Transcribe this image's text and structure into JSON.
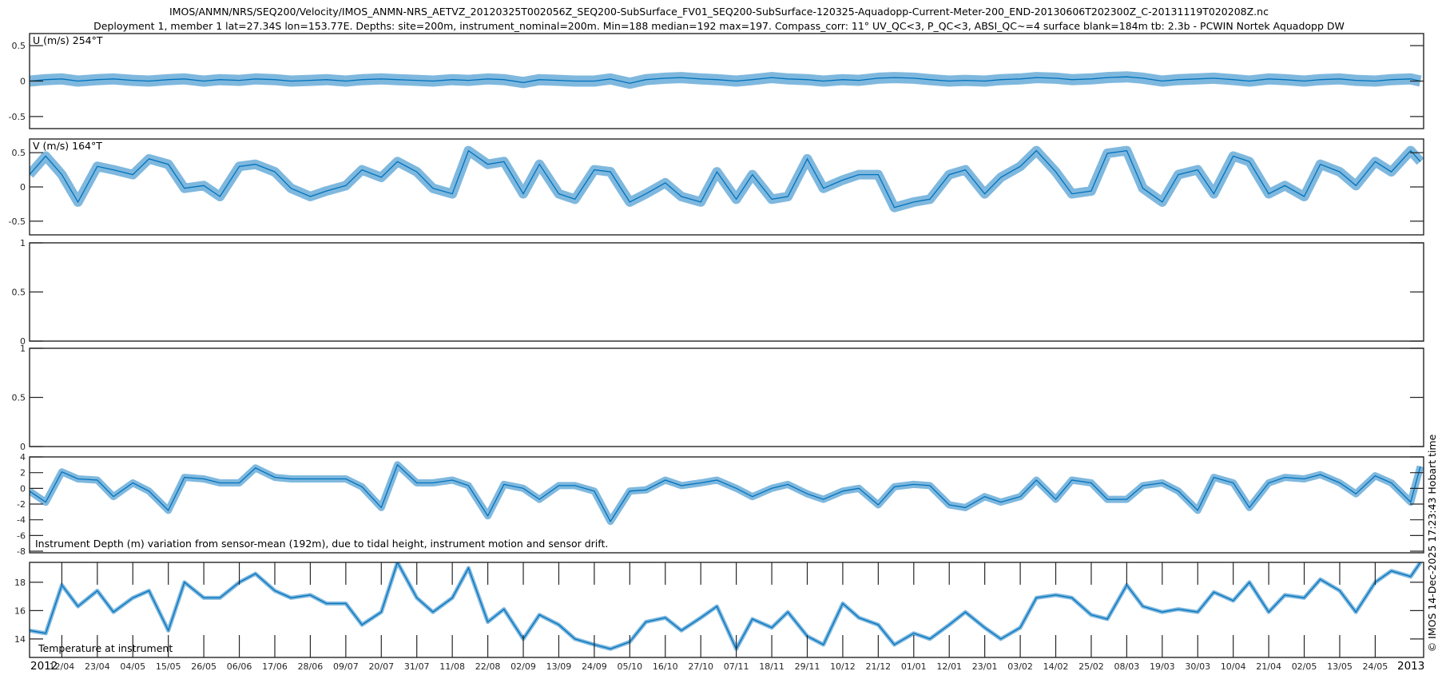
{
  "title_line1": "IMOS/ANMN/NRS/SEQ200/Velocity/IMOS_ANMN-NRS_AETVZ_20120325T002056Z_SEQ200-SubSurface_FV01_SEQ200-SubSurface-120325-Aquadopp-Current-Meter-200_END-20130606T202300Z_C-20131119T020208Z.nc",
  "title_line2": "Deployment 1, member 1 lat=27.34S lon=153.77E. Depths: site=200m, instrument_nominal=200m. Min=188 median=192 max=197. Compass_corr: 11° UV_QC<3, P_QC<3, ABSI_QC~=4 surface blank=184m tb: 2.3b - PCWIN Nortek Aquadopp DW",
  "copyright": "© IMOS 14-Dec-2025 17:23:43 Hobart time",
  "line_color": "#0072BD",
  "xaxis": {
    "xlim": [
      "2012-04-02",
      "2013-06-08"
    ],
    "year_start_label": "2012",
    "year_end_label": "2013",
    "tick_dates": [
      "2012-04-12",
      "2012-04-23",
      "2012-05-04",
      "2012-05-15",
      "2012-05-26",
      "2012-06-06",
      "2012-06-17",
      "2012-06-28",
      "2012-07-09",
      "2012-07-20",
      "2012-07-31",
      "2012-08-11",
      "2012-08-22",
      "2012-09-02",
      "2012-09-13",
      "2012-09-24",
      "2012-10-05",
      "2012-10-16",
      "2012-10-27",
      "2012-11-07",
      "2012-11-18",
      "2012-11-29",
      "2012-12-10",
      "2012-12-21",
      "2013-01-01",
      "2013-01-12",
      "2013-01-23",
      "2013-02-03",
      "2013-02-14",
      "2013-02-25",
      "2013-03-08",
      "2013-03-19",
      "2013-03-30",
      "2013-04-10",
      "2013-04-21",
      "2013-05-02",
      "2013-05-13",
      "2013-05-24"
    ],
    "tick_labels": [
      "12/04",
      "23/04",
      "04/05",
      "15/05",
      "26/05",
      "06/06",
      "17/06",
      "28/06",
      "09/07",
      "20/07",
      "31/07",
      "11/08",
      "22/08",
      "02/09",
      "13/09",
      "24/09",
      "05/10",
      "16/10",
      "27/10",
      "07/11",
      "18/11",
      "29/11",
      "10/12",
      "21/12",
      "01/01",
      "12/01",
      "23/01",
      "03/02",
      "14/02",
      "25/02",
      "08/03",
      "19/03",
      "30/03",
      "10/04",
      "21/04",
      "02/05",
      "13/05",
      "24/05"
    ]
  },
  "chart_data": [
    {
      "type": "line",
      "label": "U (m/s) 254°T",
      "ylim": [
        -0.67,
        0.67
      ],
      "yticks": [
        0.5,
        0,
        -0.5
      ],
      "ytick_labels": [
        "0.5",
        "0",
        "-0.5"
      ],
      "x": [
        "2012-04-02",
        "2012-04-07",
        "2012-04-12",
        "2012-04-17",
        "2012-04-23",
        "2012-04-28",
        "2012-05-04",
        "2012-05-09",
        "2012-05-15",
        "2012-05-20",
        "2012-05-26",
        "2012-05-31",
        "2012-06-06",
        "2012-06-11",
        "2012-06-17",
        "2012-06-22",
        "2012-06-28",
        "2012-07-03",
        "2012-07-09",
        "2012-07-14",
        "2012-07-20",
        "2012-07-25",
        "2012-07-31",
        "2012-08-05",
        "2012-08-11",
        "2012-08-16",
        "2012-08-22",
        "2012-08-27",
        "2012-09-02",
        "2012-09-07",
        "2012-09-13",
        "2012-09-18",
        "2012-09-24",
        "2012-09-29",
        "2012-10-05",
        "2012-10-10",
        "2012-10-16",
        "2012-10-21",
        "2012-10-27",
        "2012-11-01",
        "2012-11-07",
        "2012-11-12",
        "2012-11-18",
        "2012-11-23",
        "2012-11-29",
        "2012-12-04",
        "2012-12-10",
        "2012-12-15",
        "2012-12-21",
        "2012-12-26",
        "2013-01-01",
        "2013-01-06",
        "2013-01-12",
        "2013-01-17",
        "2013-01-23",
        "2013-01-28",
        "2013-02-03",
        "2013-02-08",
        "2013-02-14",
        "2013-02-19",
        "2013-02-25",
        "2013-03-02",
        "2013-03-08",
        "2013-03-13",
        "2013-03-19",
        "2013-03-24",
        "2013-03-30",
        "2013-04-04",
        "2013-04-10",
        "2013-04-15",
        "2013-04-21",
        "2013-04-26",
        "2013-05-02",
        "2013-05-07",
        "2013-05-13",
        "2013-05-18",
        "2013-05-24",
        "2013-05-29",
        "2013-06-04",
        "2013-06-07"
      ],
      "values": [
        0.0,
        0.02,
        0.03,
        0.0,
        0.02,
        0.03,
        0.01,
        0.0,
        0.02,
        0.03,
        0.0,
        0.02,
        0.01,
        0.03,
        0.02,
        0.0,
        0.01,
        0.02,
        0.0,
        0.02,
        0.03,
        0.02,
        0.01,
        0.0,
        0.02,
        0.01,
        0.03,
        0.02,
        -0.02,
        0.02,
        0.01,
        0.0,
        0.0,
        0.03,
        -0.03,
        0.02,
        0.04,
        0.05,
        0.03,
        0.02,
        0.0,
        0.02,
        0.05,
        0.03,
        0.02,
        0.0,
        0.02,
        0.01,
        0.04,
        0.05,
        0.04,
        0.02,
        0.0,
        0.01,
        0.0,
        0.02,
        0.03,
        0.05,
        0.04,
        0.02,
        0.03,
        0.05,
        0.06,
        0.04,
        0.0,
        0.02,
        0.03,
        0.04,
        0.02,
        0.0,
        0.03,
        0.02,
        0.0,
        0.02,
        0.03,
        0.01,
        0.0,
        0.02,
        0.03,
        0.0
      ]
    },
    {
      "type": "line",
      "label": "V (m/s) 164°T",
      "ylim": [
        -0.7,
        0.7
      ],
      "yticks": [
        0.5,
        0,
        -0.5
      ],
      "ytick_labels": [
        "0.5",
        "0",
        "-0.5"
      ],
      "values": [
        0.18,
        0.45,
        0.18,
        -0.22,
        0.3,
        0.25,
        0.18,
        0.41,
        0.33,
        -0.02,
        0.02,
        -0.14,
        0.3,
        0.33,
        0.22,
        -0.02,
        -0.14,
        -0.06,
        0.02,
        0.25,
        0.14,
        0.37,
        0.22,
        -0.02,
        -0.1,
        0.53,
        0.33,
        0.37,
        -0.1,
        0.33,
        -0.1,
        -0.18,
        0.25,
        0.22,
        -0.22,
        -0.1,
        0.06,
        -0.14,
        -0.22,
        0.22,
        -0.18,
        0.18,
        -0.18,
        -0.14,
        0.41,
        -0.02,
        0.1,
        0.18,
        0.18,
        -0.3,
        -0.22,
        -0.18,
        0.18,
        0.25,
        -0.1,
        0.14,
        0.3,
        0.53,
        0.22,
        -0.1,
        -0.06,
        0.49,
        0.53,
        -0.02,
        -0.22,
        0.18,
        0.25,
        -0.1,
        0.45,
        0.37,
        -0.1,
        0.02,
        -0.14,
        0.33,
        0.22,
        0.02,
        0.37,
        0.22,
        0.53,
        0.37
      ]
    },
    {
      "type": "line",
      "label": "",
      "ylim": [
        0,
        1
      ],
      "yticks": [
        1,
        0.5,
        0
      ],
      "ytick_labels": [
        "1",
        "0.5",
        "0"
      ],
      "values": []
    },
    {
      "type": "line",
      "label": "",
      "ylim": [
        0,
        1
      ],
      "yticks": [
        1,
        0.5,
        0
      ],
      "ytick_labels": [
        "1",
        "0.5",
        "0"
      ],
      "values": []
    },
    {
      "type": "line",
      "label": "Instrument Depth (m) variation from sensor-mean (192m), due to tidal height, instrument motion and sensor drift.",
      "ylim": [
        -8.2,
        4
      ],
      "yticks": [
        4,
        2,
        0,
        -2,
        -4,
        -6,
        -8
      ],
      "ytick_labels": [
        "4",
        "2",
        "0",
        "-2",
        "-4",
        "-6",
        "-8"
      ],
      "values": [
        -0.35,
        -1.75,
        2.1,
        1.2,
        1.05,
        -1.05,
        0.7,
        -0.35,
        -2.8,
        1.4,
        1.2,
        0.7,
        0.7,
        2.6,
        1.4,
        1.2,
        1.2,
        1.2,
        1.2,
        0.2,
        -2.45,
        3.0,
        0.7,
        0.7,
        1.05,
        0.35,
        -3.5,
        0.5,
        0,
        -1.4,
        0.35,
        0.35,
        -0.35,
        -4.2,
        -0.35,
        -0.2,
        1.05,
        0.35,
        0.7,
        1.05,
        0,
        -1.05,
        0,
        0.5,
        -0.7,
        -1.4,
        -0.35,
        0,
        -2.1,
        0.2,
        0.5,
        0.35,
        -2.1,
        -2.45,
        -1.05,
        -1.75,
        -1.05,
        1.05,
        -1.4,
        1.05,
        0.7,
        -1.4,
        -1.4,
        0.35,
        0.7,
        -0.35,
        -2.8,
        1.4,
        0.7,
        -2.45,
        0.7,
        1.4,
        1.2,
        1.75,
        0.7,
        -0.7,
        1.6,
        0.7,
        -1.75,
        2.8
      ]
    },
    {
      "type": "line",
      "label": "Temperature at instrument",
      "ylim": [
        12.7,
        19.4
      ],
      "yticks": [
        18,
        16,
        14
      ],
      "ytick_labels": [
        "18",
        "16",
        "14"
      ],
      "values": [
        14.6,
        14.4,
        17.8,
        16.3,
        17.4,
        15.9,
        16.9,
        17.4,
        14.6,
        18.0,
        16.9,
        16.9,
        18.0,
        18.6,
        17.4,
        16.9,
        17.1,
        16.5,
        16.5,
        15.0,
        15.9,
        19.4,
        16.9,
        15.9,
        16.9,
        19.0,
        15.2,
        16.1,
        14.0,
        15.7,
        15.0,
        14.0,
        13.6,
        13.3,
        13.8,
        15.2,
        15.5,
        14.6,
        15.5,
        16.3,
        13.3,
        15.4,
        14.8,
        15.9,
        14.2,
        13.6,
        16.5,
        15.5,
        15.0,
        13.6,
        14.4,
        14.0,
        15.0,
        15.9,
        14.8,
        14.0,
        14.8,
        16.9,
        17.1,
        16.9,
        15.7,
        15.4,
        17.8,
        16.3,
        15.9,
        16.1,
        15.9,
        17.3,
        16.7,
        18.0,
        15.9,
        17.1,
        16.9,
        18.2,
        17.4,
        15.9,
        18.0,
        18.8,
        18.4,
        19.4
      ]
    }
  ]
}
